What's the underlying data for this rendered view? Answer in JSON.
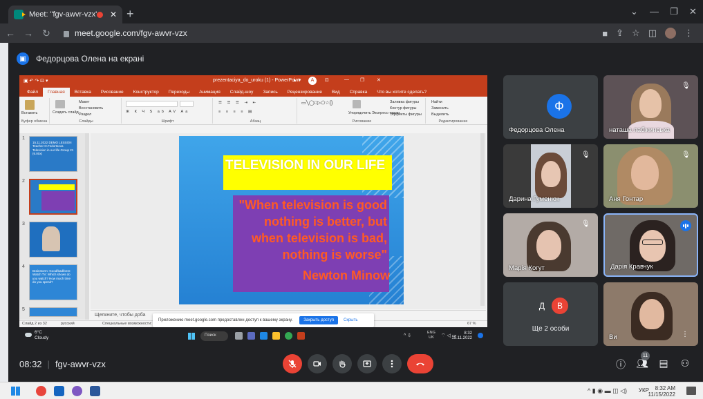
{
  "browser": {
    "tab_title": "Meet: \"fgv-awvr-vzx\"",
    "tab_close": "✕",
    "new_tab": "+",
    "url": "meet.google.com/fgv-awvr-vzx"
  },
  "meet": {
    "presenter_label": "Федорцова Олена на екрані",
    "meeting_time": "08:32",
    "meeting_code": "fgv-awvr-vzx",
    "participant_count": "11",
    "tiles": [
      {
        "name": "Федорцова Олена",
        "initial": "Ф"
      },
      {
        "name": "наташа лабжинська"
      },
      {
        "name": "Дарина Гуменюк"
      },
      {
        "name": "Аня Гонтар"
      },
      {
        "name": "Марія Когут"
      },
      {
        "name": "Дарія Кравчук"
      },
      {
        "name": "Ще 2 особи",
        "initials": [
          "Д",
          "В"
        ]
      },
      {
        "name": "Ви"
      }
    ]
  },
  "ppt": {
    "window_title": "prezentaciya_do_uroku (1) - PowerPoint",
    "user_initial": "A",
    "menu": [
      "Файл",
      "Главная",
      "Вставка",
      "Рисование",
      "Конструктор",
      "Переходы",
      "Анимация",
      "Слайд-шоу",
      "Запись",
      "Рецензирование",
      "Вид",
      "Справка",
      "Что вы хотите сделать?"
    ],
    "ribbon": {
      "paste": "Вставить",
      "create_slide": "Создать слайд",
      "layout": "Макет",
      "restore": "Восстановить",
      "section": "Раздел",
      "arrange": "Упорядочить",
      "express_styles": "Экспресс-стили",
      "shape_fill": "Заливка фигуры",
      "shape_outline": "Контур фигуры",
      "shape_effects": "Эффекты фигуры",
      "find": "Найти",
      "replace": "Заменить",
      "select": "Выделить",
      "groups": [
        "Буфер обмена",
        "Слайды",
        "Шрифт",
        "Абзац",
        "Рисование",
        "Редактирование"
      ]
    },
    "thumbnails": [
      {
        "num": "1",
        "text": "15.11.2022 DEMO LESSON Teacher O.Fedortsova Television in our life Group 21 (6.00x)"
      },
      {
        "num": "2",
        "text": ""
      },
      {
        "num": "3",
        "text": ""
      },
      {
        "num": "4",
        "text": "Brainstorm: Good/bad/best: Watch TV: Which shows do you watch? How much time do you spend?"
      },
      {
        "num": "5",
        "text": ""
      }
    ],
    "slide": {
      "title": "TELEVISION IN OUR LIFE",
      "quote": "\"When television is good nothing is better, but when television is bad, nothing is worse\"",
      "author": "Newton Minow"
    },
    "notes_placeholder": "Щелкните, чтобы доба",
    "status_left": "Слайд 2 из 32",
    "status_lang": "русский",
    "status_accessibility": "Специальные возможности: проверьте рекомендации",
    "zoom": "67 %"
  },
  "share_notice": {
    "text": "Приложению meet.google.com предоставлен доступ к вашему экрану.",
    "stop": "Закрыть доступ",
    "hide": "Скрыть"
  },
  "inner_taskbar": {
    "temp": "6°C",
    "weather": "Cloudy",
    "search": "Поиск",
    "lang1": "ENG",
    "lang2": "UK",
    "time": "8:32",
    "date": "15.11.2022"
  },
  "os_taskbar": {
    "lang": "УКР",
    "time": "8:32 AM",
    "date": "11/15/2022"
  },
  "colors": {
    "meet_bg": "#202124",
    "ppt_accent": "#c43e1c",
    "end_call": "#ea4335",
    "active_border": "#8ab4f8"
  }
}
